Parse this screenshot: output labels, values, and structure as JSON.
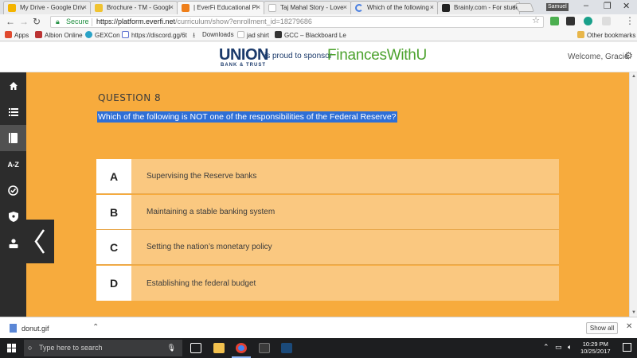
{
  "browser": {
    "tabs": [
      {
        "title": "My Drive - Google Drive",
        "icon": "google-drive-icon",
        "color": "#f4b400",
        "active": false
      },
      {
        "title": "Brochure - TM - Google Docs",
        "icon": "google-docs-icon",
        "color": "#f0c330",
        "active": false
      },
      {
        "title": "| EverFi Educational Platform",
        "icon": "everfi-icon",
        "color": "#ef7f1a",
        "active": true
      },
      {
        "title": "Taj Mahal Story - Love",
        "icon": "page-icon",
        "color": "#bdbdbd",
        "active": false
      },
      {
        "title": "Which of the following",
        "icon": "loading-icon",
        "color": "#4a7fe0",
        "active": false
      },
      {
        "title": "Brainly.com - For students",
        "icon": "brainly-icon",
        "color": "#222222",
        "active": false
      }
    ],
    "user_badge": "Samuel",
    "address": {
      "secure_label": "Secure",
      "url_host": "https://platform.everfi.net",
      "url_path": "/curriculum/show?enrollment_id=18279686"
    },
    "bookmarks": [
      {
        "label": "Apps",
        "icon": "apps-icon",
        "color": "#e04a2f"
      },
      {
        "label": "Albion Online",
        "icon": "albion-icon",
        "color": "#b33"
      },
      {
        "label": "GEXCon",
        "icon": "gexcon-icon",
        "color": "#2aa3c7"
      },
      {
        "label": "https://discord.gg/6t",
        "icon": "discord-icon",
        "color": "#5a6fcf"
      },
      {
        "label": "Downloads",
        "icon": "download-icon",
        "color": "#555"
      },
      {
        "label": "jad shirt",
        "icon": "page-icon",
        "color": "#bbb"
      },
      {
        "label": "GCC – Blackboard Le",
        "icon": "blackboard-icon",
        "color": "#333"
      },
      {
        "label": "Other bookmarks",
        "icon": "folder-icon",
        "color": "#e8b64a"
      }
    ]
  },
  "header": {
    "logo_union": "UNION",
    "logo_bank": "BANK & TRUST",
    "sponsor_text": "is proud to sponsor",
    "brand": "FinancesWithU",
    "welcome": "Welcome, Gracie"
  },
  "sidebar": {
    "items": [
      {
        "name": "home",
        "icon": "home-icon"
      },
      {
        "name": "list",
        "icon": "list-icon"
      },
      {
        "name": "notebook",
        "icon": "notebook-icon"
      },
      {
        "name": "glossary",
        "icon": "az-icon",
        "label": "A-Z"
      },
      {
        "name": "checklist",
        "icon": "check-badge-icon"
      },
      {
        "name": "shield",
        "icon": "shield-icon"
      },
      {
        "name": "profile",
        "icon": "person-icon"
      }
    ]
  },
  "question": {
    "label": "QUESTION 8",
    "text": "Which of the following is NOT one of the responsibilities of the Federal Reserve?",
    "answers": [
      {
        "letter": "A",
        "text": "Supervising the Reserve banks"
      },
      {
        "letter": "B",
        "text": "Maintaining a stable banking system"
      },
      {
        "letter": "C",
        "text": "Setting the nation’s monetary policy"
      },
      {
        "letter": "D",
        "text": "Establishing the federal budget"
      }
    ]
  },
  "downloads": {
    "file": "donut.gif",
    "show_all": "Show all"
  },
  "taskbar": {
    "search_placeholder": "Type here to search",
    "time": "10:29 PM",
    "date": "10/25/2017"
  },
  "colors": {
    "main_bg": "#f7ab3d",
    "answer_bg": "#fac880",
    "sidebar_bg": "#2c2c2c",
    "highlight": "#2f6fd6"
  }
}
